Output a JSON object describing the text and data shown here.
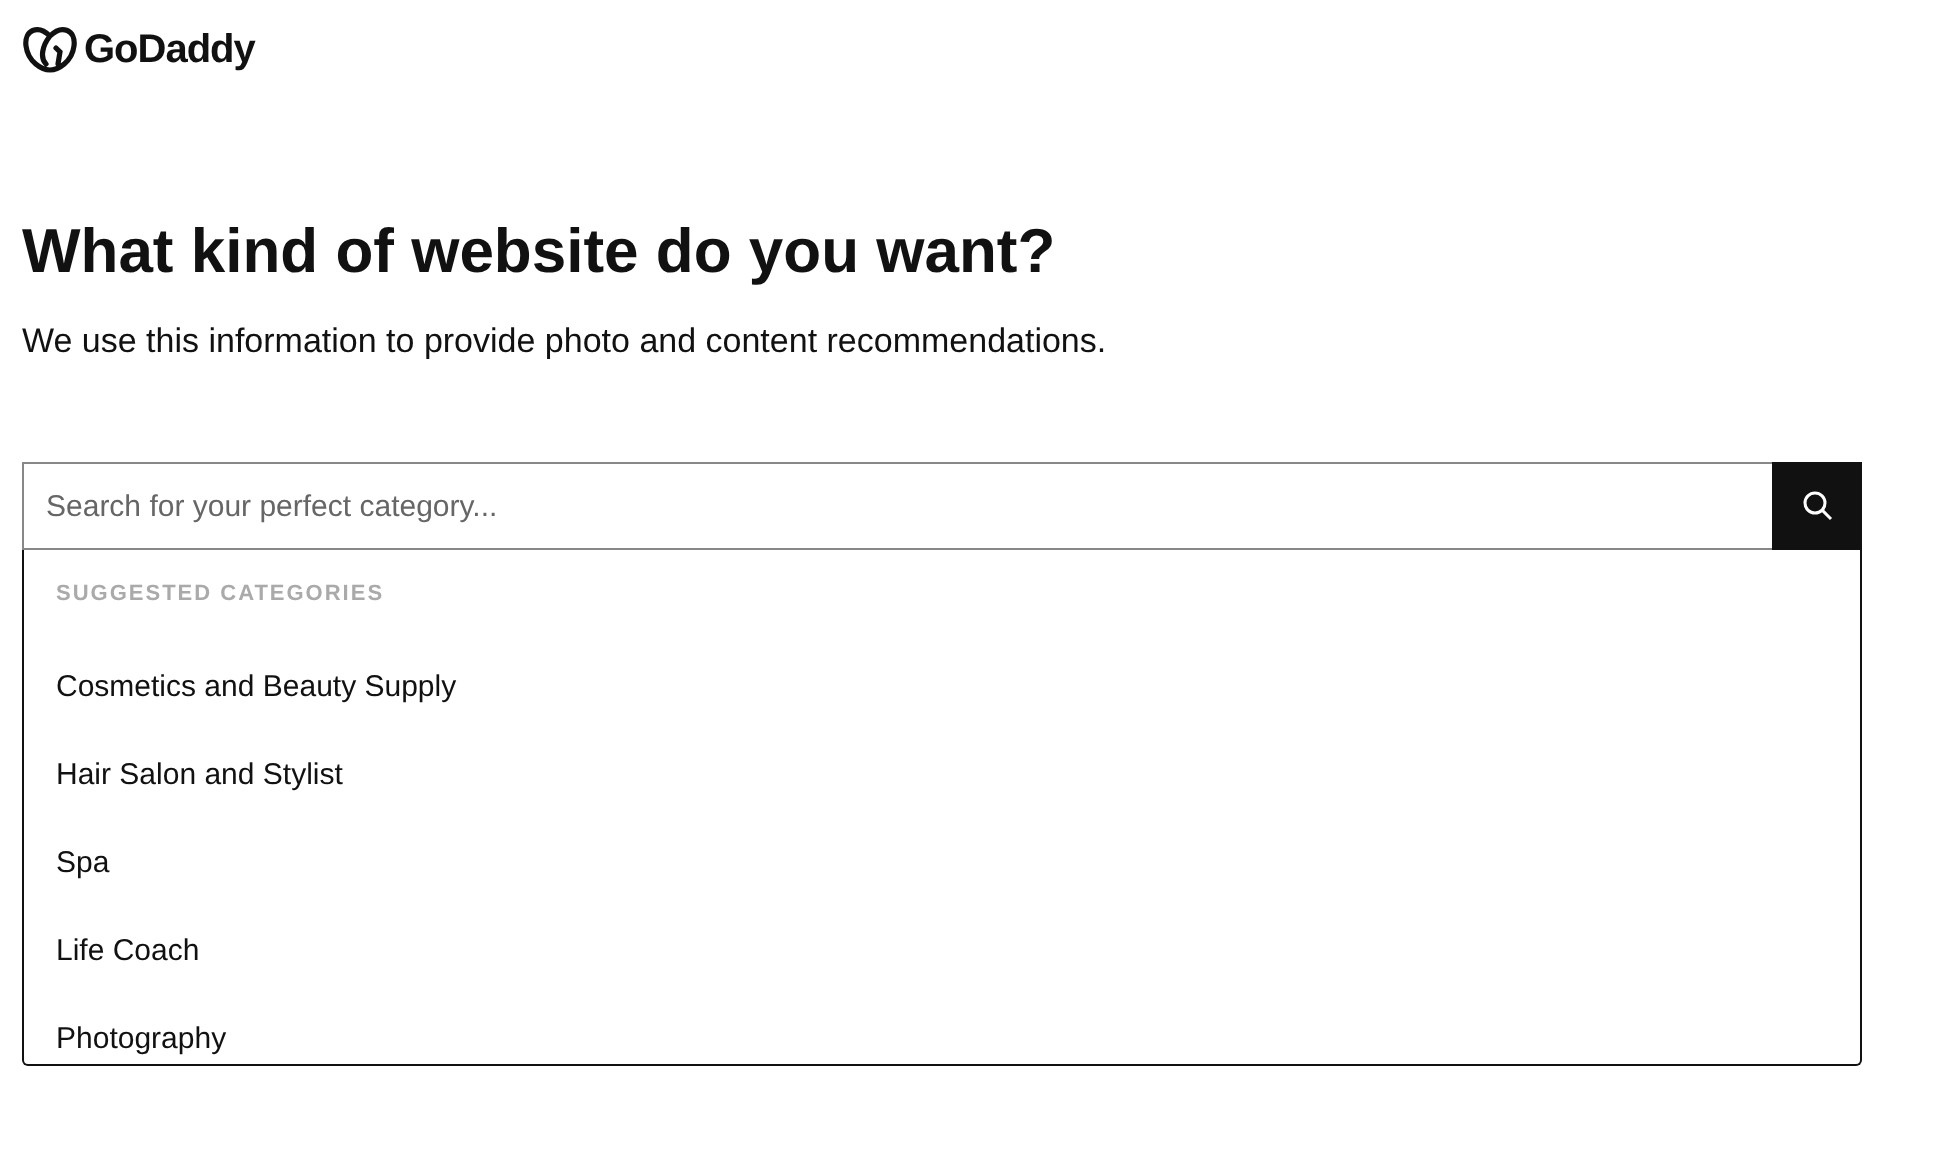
{
  "header": {
    "brand": "GoDaddy"
  },
  "title": "What kind of website do you want?",
  "subtitle": "We use this information to provide photo and content recommendations.",
  "search": {
    "placeholder": "Search for your perfect category..."
  },
  "suggestions": {
    "heading": "SUGGESTED CATEGORIES",
    "items": [
      "Cosmetics and Beauty Supply",
      "Hair Salon and Stylist",
      "Spa",
      "Life Coach",
      "Photography"
    ]
  }
}
